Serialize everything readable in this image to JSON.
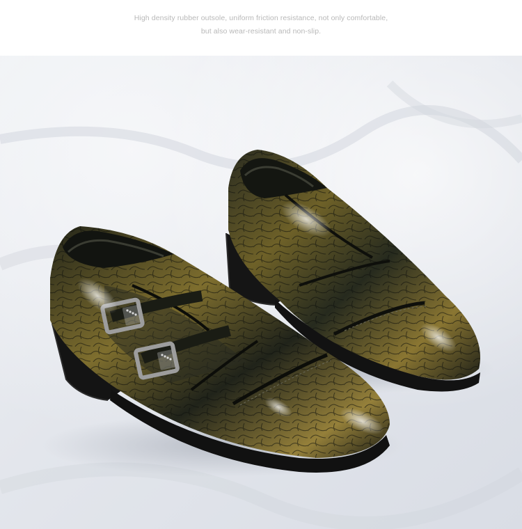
{
  "caption": {
    "line1": "High density rubber outsole, uniform friction resistance, not only comfortable,",
    "line2": "but also wear-resistant and non-slip."
  },
  "photo": {
    "subject": "shoes-photo",
    "colors": {
      "background": "#e8eaef",
      "leather_dark": "#1d1f17",
      "leather_gold": "#8d7a35",
      "sole": "#141414",
      "buckle": "#9a9a9a"
    }
  }
}
